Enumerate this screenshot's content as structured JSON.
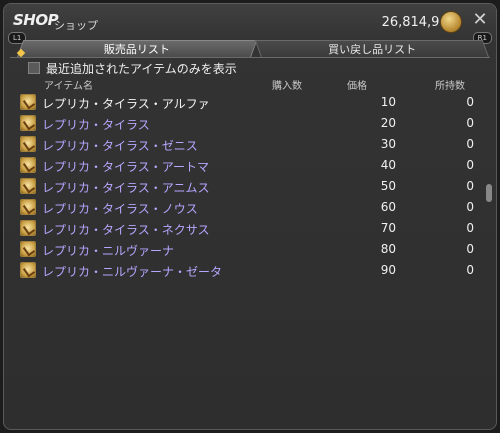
{
  "header": {
    "title": "SHOP",
    "subtitle": "ショップ",
    "gil": "26,814,963",
    "badge_left": "L1",
    "badge_right": "R1",
    "gil_icon": "gil-coin-icon",
    "close_icon": "crossed-swords-icon"
  },
  "tabs": [
    {
      "label": "販売品リスト",
      "active": true
    },
    {
      "label": "買い戻し品リスト",
      "active": false
    }
  ],
  "filter": {
    "label": "最近追加されたアイテムのみを表示",
    "checked": false
  },
  "columns": {
    "name": "アイテム名",
    "qty": "購入数",
    "price": "価格",
    "owned": "所持数"
  },
  "items": [
    {
      "name": "レプリカ・タイラス・アルファ",
      "price": "10",
      "owned": "0",
      "color": "#f4f4f4"
    },
    {
      "name": "レプリカ・タイラス",
      "price": "20",
      "owned": "0",
      "color": "#b7a5ff"
    },
    {
      "name": "レプリカ・タイラス・ゼニス",
      "price": "30",
      "owned": "0",
      "color": "#b7a5ff"
    },
    {
      "name": "レプリカ・タイラス・アートマ",
      "price": "40",
      "owned": "0",
      "color": "#b7a5ff"
    },
    {
      "name": "レプリカ・タイラス・アニムス",
      "price": "50",
      "owned": "0",
      "color": "#b7a5ff"
    },
    {
      "name": "レプリカ・タイラス・ノウス",
      "price": "60",
      "owned": "0",
      "color": "#b7a5ff"
    },
    {
      "name": "レプリカ・タイラス・ネクサス",
      "price": "70",
      "owned": "0",
      "color": "#b7a5ff"
    },
    {
      "name": "レプリカ・ニルヴァーナ",
      "price": "80",
      "owned": "0",
      "color": "#b7a5ff"
    },
    {
      "name": "レプリカ・ニルヴァーナ・ゼータ",
      "price": "90",
      "owned": "0",
      "color": "#b7a5ff"
    }
  ]
}
